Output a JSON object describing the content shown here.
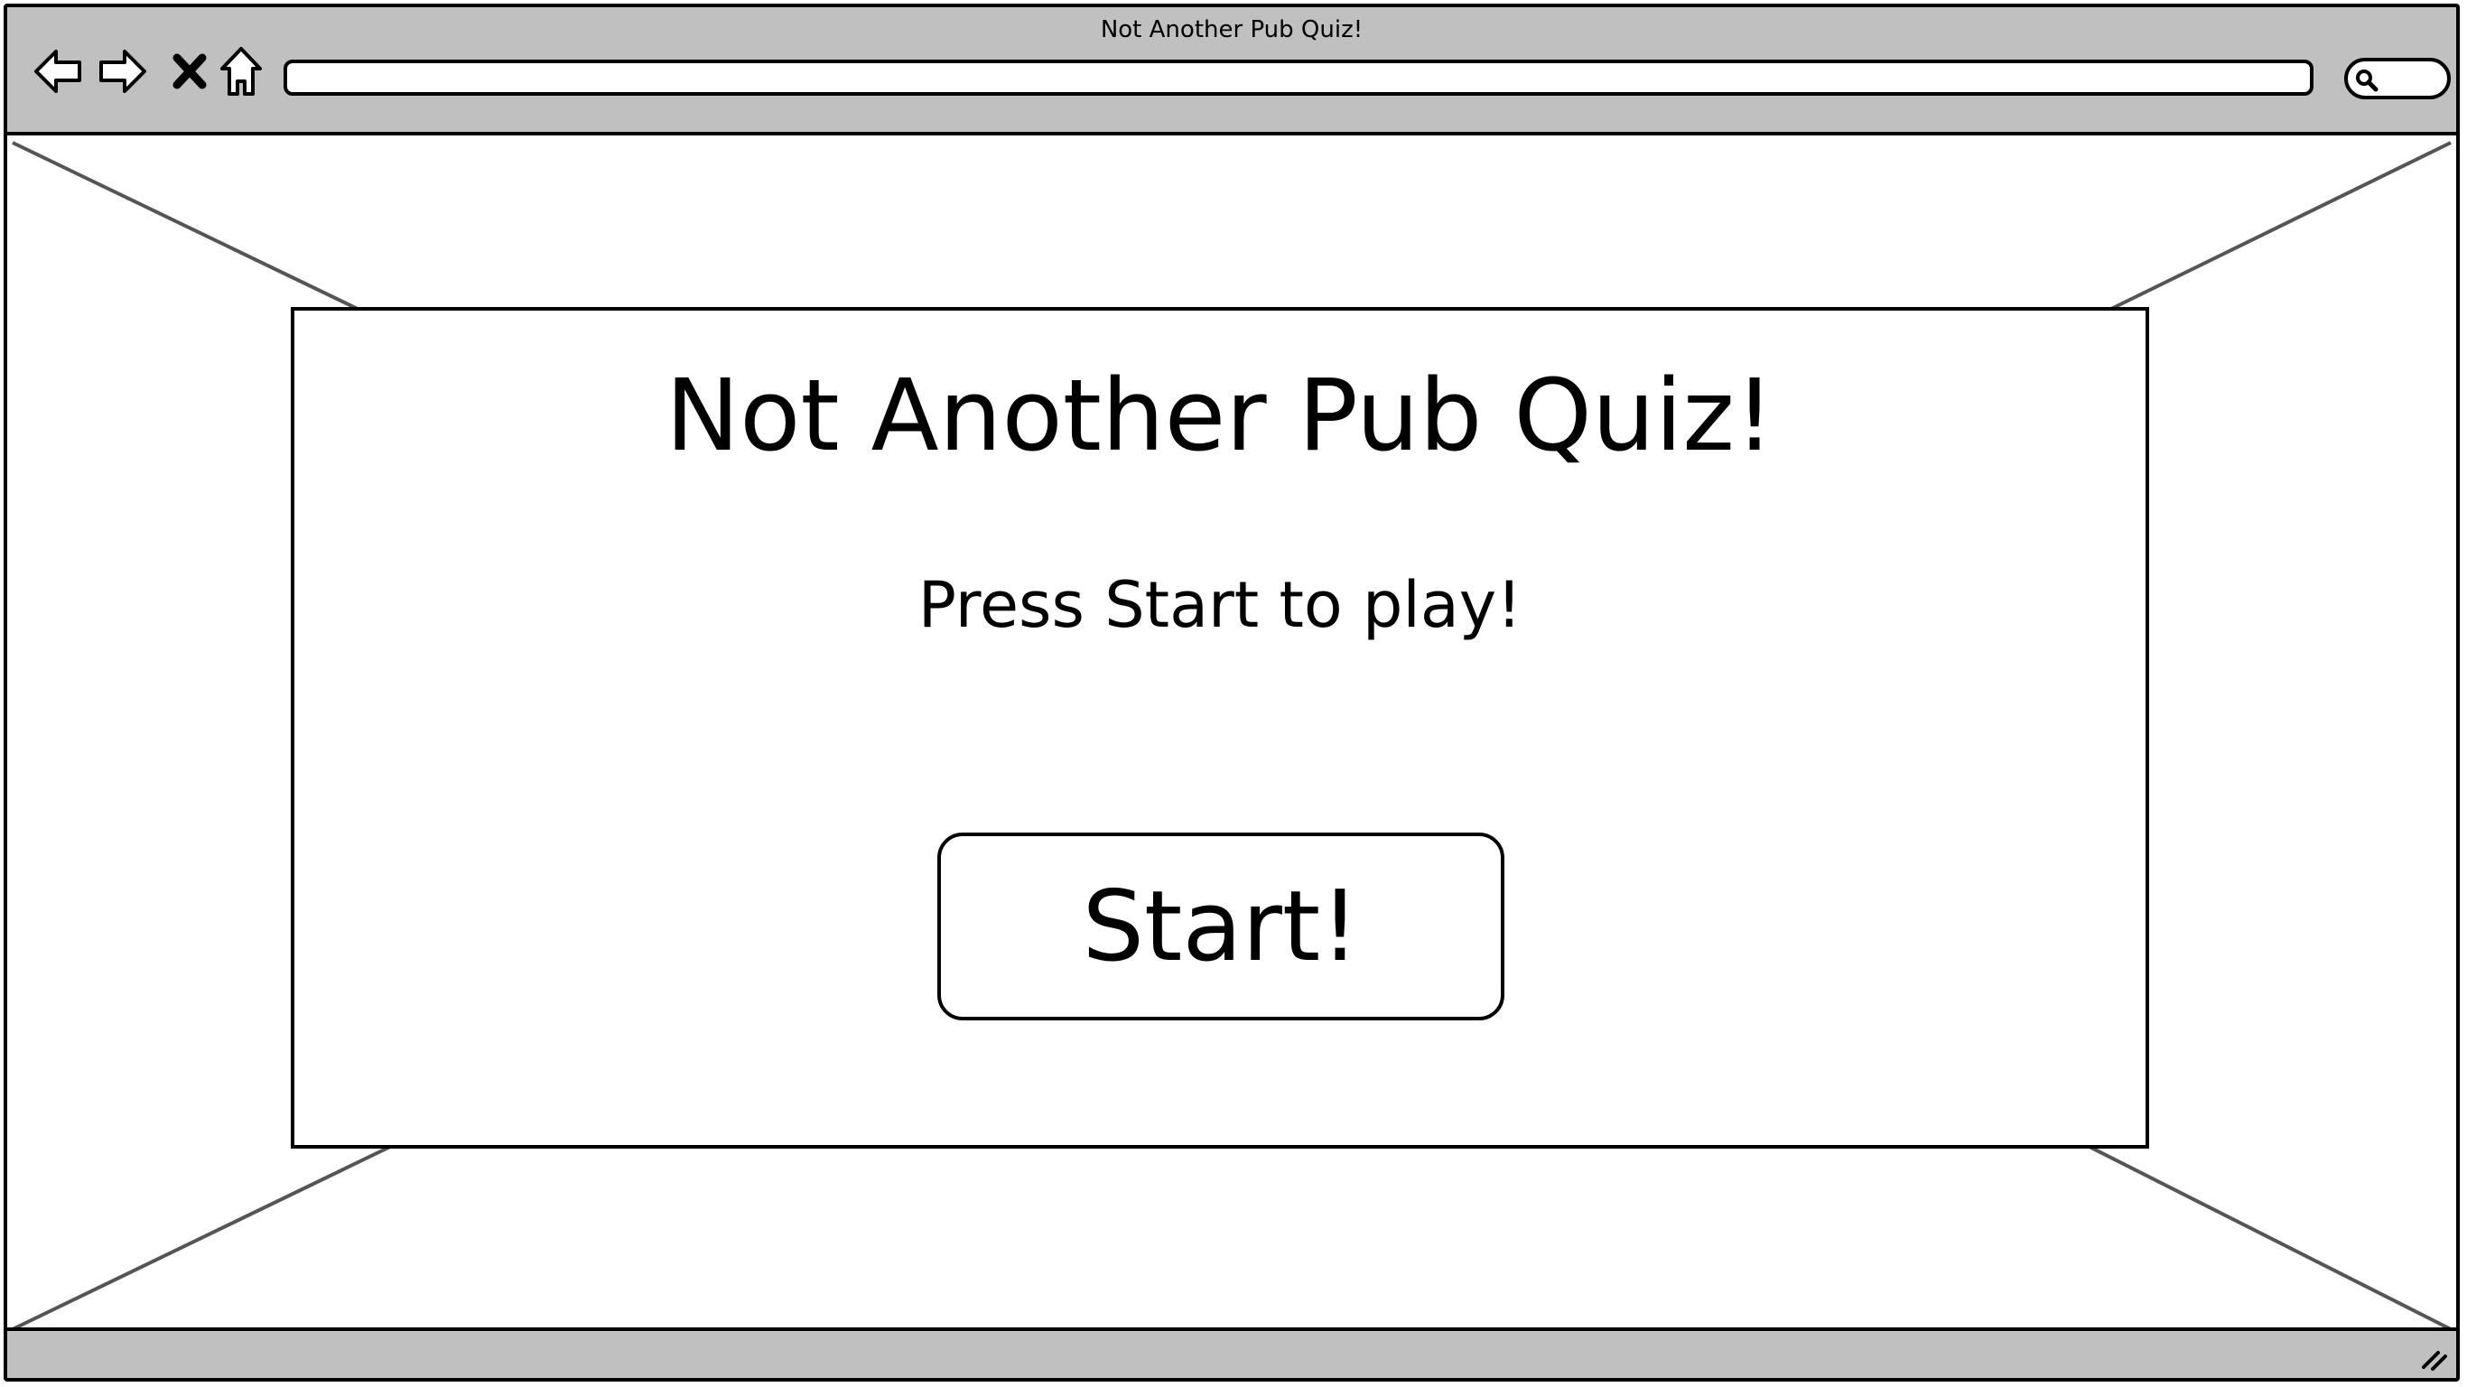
{
  "window": {
    "title": "Not Another Pub Quiz!"
  },
  "toolbar": {
    "icons": [
      "back-arrow-icon",
      "forward-arrow-icon",
      "stop-icon",
      "home-icon",
      "search-icon"
    ],
    "address_value": ""
  },
  "main": {
    "title": "Not Another Pub Quiz!",
    "subtitle": "Press Start to play!",
    "start_label": "Start!"
  },
  "colors": {
    "chrome": "#c0c0c0",
    "border": "#000000",
    "background": "#ffffff",
    "placeholder_line": "#555555"
  }
}
